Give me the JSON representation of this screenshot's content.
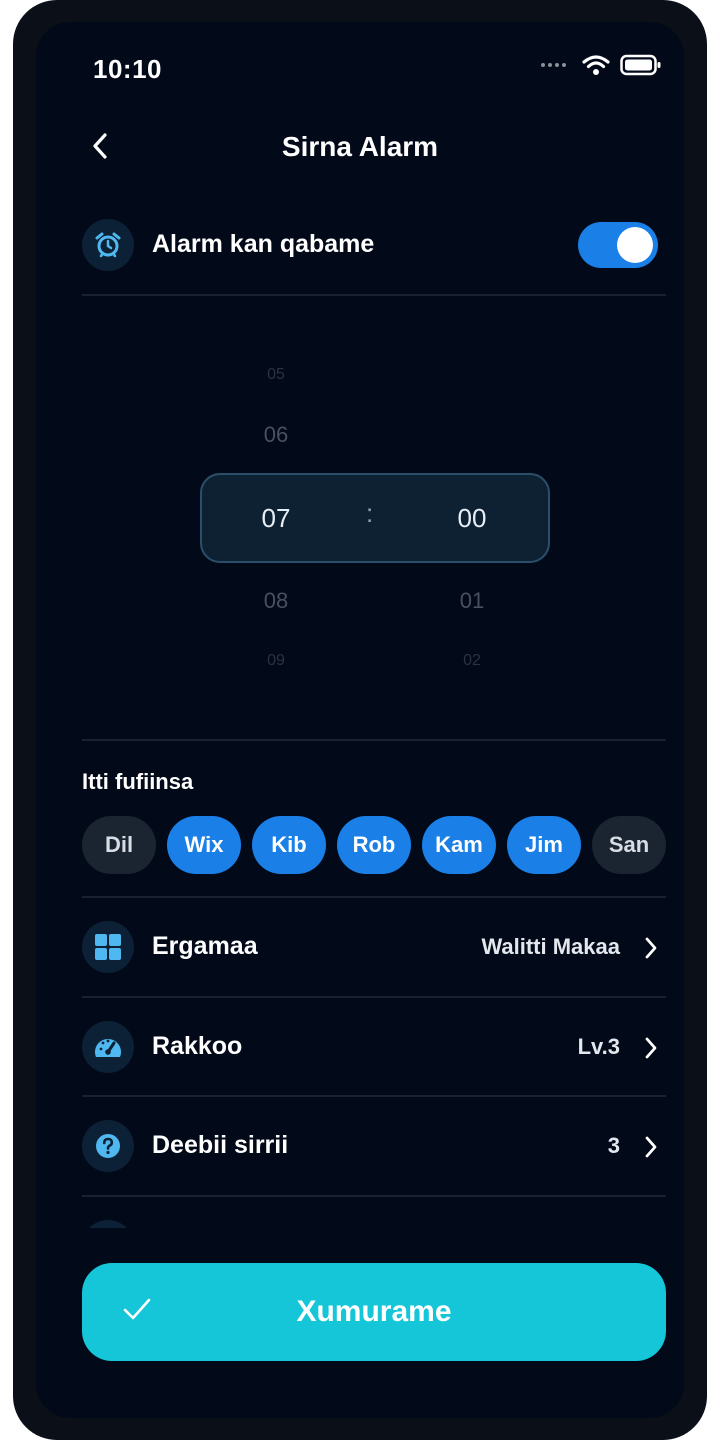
{
  "status_bar": {
    "time": "10:10"
  },
  "header": {
    "title": "Sirna Alarm"
  },
  "alarm_toggle": {
    "label": "Alarm kan qabame",
    "enabled": true
  },
  "time_picker": {
    "hours": {
      "prev2": "05",
      "prev1": "06",
      "selected": "07",
      "next1": "08",
      "next2": "09"
    },
    "separator": ":",
    "minutes": {
      "selected": "00",
      "next1": "01",
      "next2": "02"
    }
  },
  "repeat": {
    "label": "Itti fufiinsa",
    "days": [
      {
        "label": "Dil",
        "active": false
      },
      {
        "label": "Wix",
        "active": true
      },
      {
        "label": "Kib",
        "active": true
      },
      {
        "label": "Rob",
        "active": true
      },
      {
        "label": "Kam",
        "active": true
      },
      {
        "label": "Jim",
        "active": true
      },
      {
        "label": "San",
        "active": false
      }
    ]
  },
  "settings": [
    {
      "label": "Ergamaa",
      "value": "Walitti Makaa",
      "icon": "grid-icon"
    },
    {
      "label": "Rakkoo",
      "value": "Lv.3",
      "icon": "gauge-icon"
    },
    {
      "label": "Deebii sirrii",
      "value": "3",
      "icon": "question-icon"
    }
  ],
  "actions": {
    "save_label": "Xumurame"
  },
  "colors": {
    "accent": "#1a7fe6",
    "cta": "#14c6d8",
    "background": "#020918"
  }
}
